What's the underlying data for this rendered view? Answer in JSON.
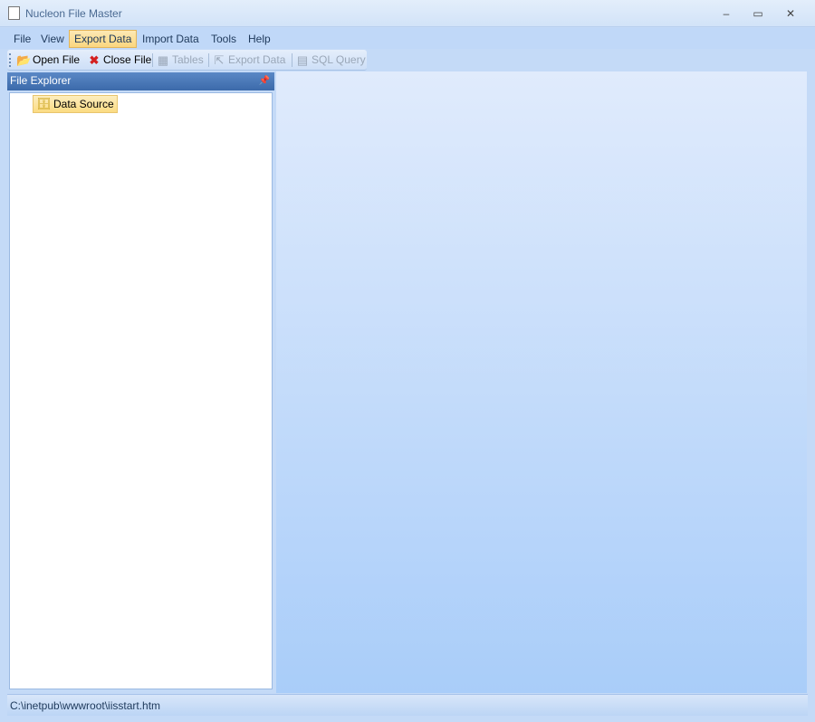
{
  "window": {
    "title": "Nucleon File Master",
    "minimize": "–",
    "maximize": "▭",
    "close": "✕"
  },
  "menu": [
    "File",
    "View",
    "Export Data",
    "Import Data",
    "Tools",
    "Help"
  ],
  "toolbar": {
    "open_file": "Open File",
    "close_file": "Close File",
    "tables": "Tables",
    "export_data": "Export Data",
    "sql_query": "SQL Query"
  },
  "panel": {
    "title": "File Explorer",
    "pin": "📌"
  },
  "tree": {
    "root": "Data Source"
  },
  "status": {
    "path": "C:\\inetpub\\wwwroot\\iisstart.htm"
  }
}
